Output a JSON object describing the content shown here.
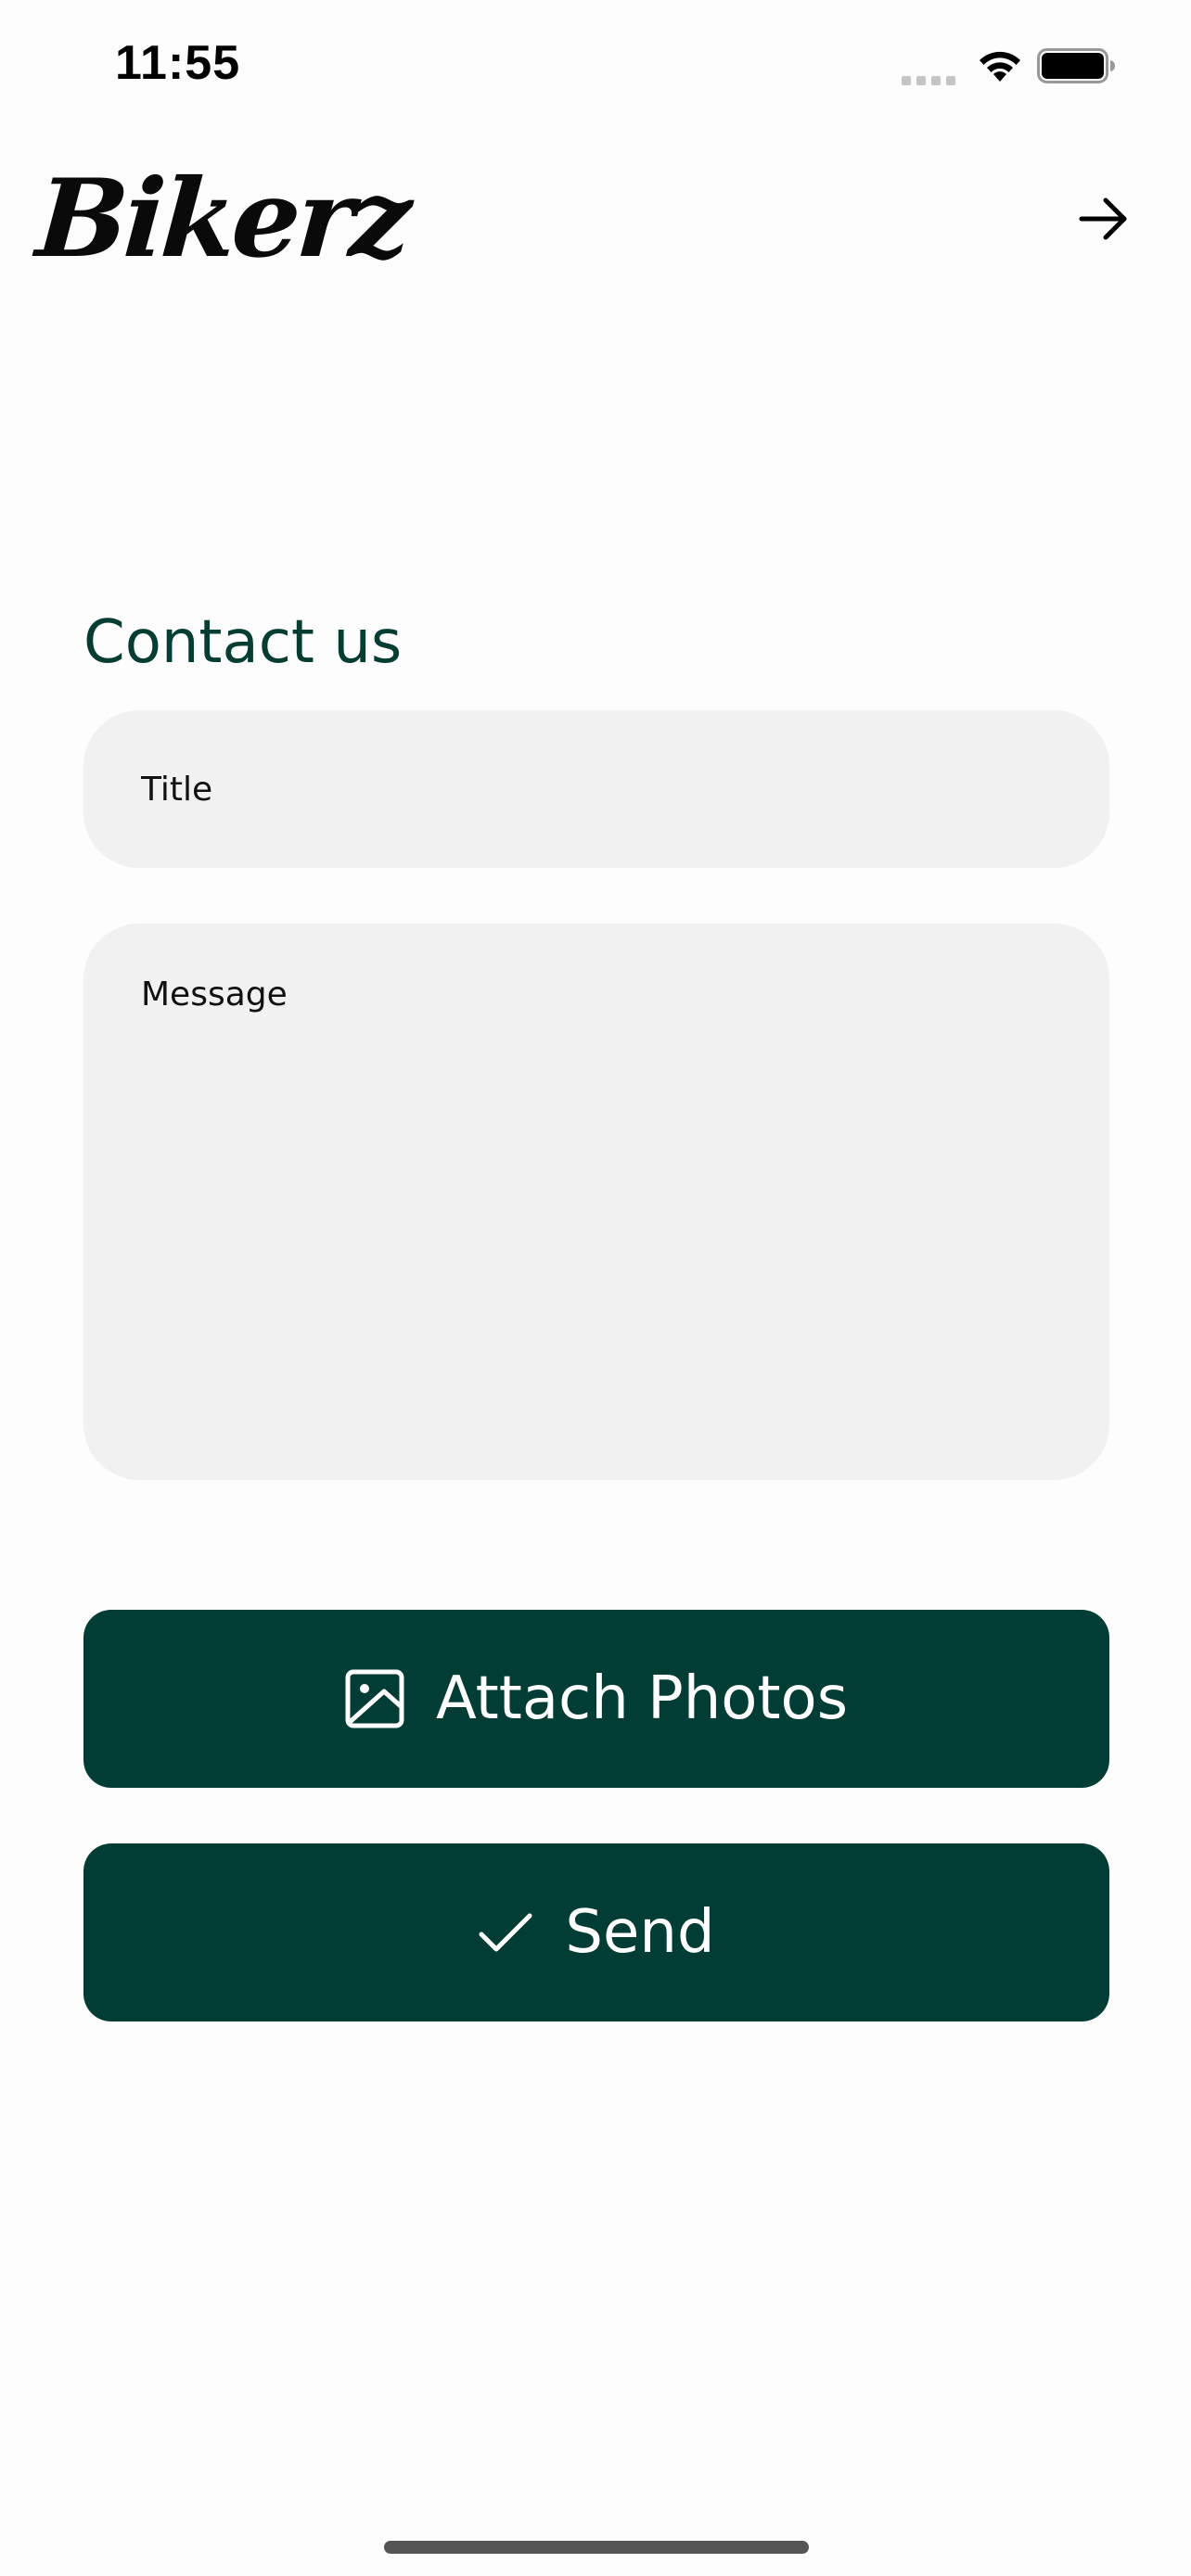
{
  "status_bar": {
    "time": "11:55"
  },
  "header": {
    "logo_text": "Bikerz",
    "nav_icon": "arrow-right-icon"
  },
  "contact_form": {
    "title": "Contact us",
    "title_field": {
      "placeholder": "Title",
      "value": ""
    },
    "message_field": {
      "placeholder": "Message",
      "value": ""
    },
    "attach_button": {
      "label": "Attach Photos",
      "icon": "image-icon"
    },
    "send_button": {
      "label": "Send",
      "icon": "checkmark-icon"
    }
  },
  "colors": {
    "primary": "#023d35",
    "title_text": "#063d33",
    "field_background": "#f1f1f1",
    "page_background": "#fdfdfd"
  }
}
